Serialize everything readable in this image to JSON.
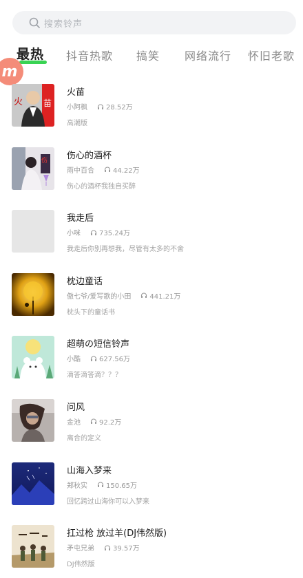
{
  "search": {
    "placeholder": "搜索铃声",
    "icon": "search-icon"
  },
  "tabs": [
    {
      "label": "最热",
      "active": true
    },
    {
      "label": "抖音热歌",
      "active": false
    },
    {
      "label": "搞笑",
      "active": false
    },
    {
      "label": "网络流行",
      "active": false
    },
    {
      "label": "怀旧老歌",
      "active": false
    }
  ],
  "colors": {
    "accent": "#39d353",
    "badge": "#f27862"
  },
  "badge": {
    "text": "m"
  },
  "songs": [
    {
      "title": "火苗",
      "artist": "小阿枫",
      "plays": "28.52万",
      "desc": "高潮版",
      "cover": "cover-man-fire"
    },
    {
      "title": "伤心的酒杯",
      "artist": "雨中百合",
      "plays": "44.22万",
      "desc": "伤心的酒杯我独自买醉",
      "cover": "cover-woman-wine"
    },
    {
      "title": "我走后",
      "artist": "小咪",
      "plays": "735.24万",
      "desc": "我走后你别再想我，尽管有太多的不舍",
      "cover": "cover-placeholder"
    },
    {
      "title": "枕边童话",
      "artist": "傲七爷/爱写歌的小田",
      "plays": "441.21万",
      "desc": "枕头下的童话书",
      "cover": "cover-golden-tree"
    },
    {
      "title": "超萌の短信铃声",
      "artist": "小酷",
      "plays": "627.56万",
      "desc": "滴答滴答滴？？？",
      "cover": "cover-cute-bear"
    },
    {
      "title": "问风",
      "artist": "金池",
      "plays": "92.2万",
      "desc": "离合的定义",
      "cover": "cover-wind-girl"
    },
    {
      "title": "山海入梦来",
      "artist": "郑秋实",
      "plays": "150.65万",
      "desc": "回忆跨过山海你可以入梦来",
      "cover": "cover-mountain-sea"
    },
    {
      "title": "扛过枪 放过羊(DJ伟然版)",
      "artist": "矛屯兄弟",
      "plays": "39.57万",
      "desc": "DJ伟然版",
      "cover": "cover-soldiers"
    }
  ]
}
